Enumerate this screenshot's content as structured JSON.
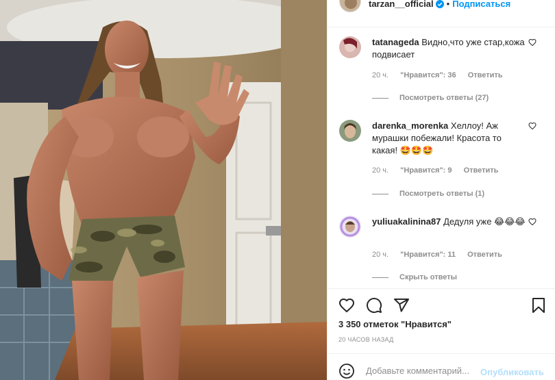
{
  "post": {
    "username": "tarzan__official",
    "verified": true,
    "separator": "•",
    "follow_label": "Подписаться"
  },
  "comments": [
    {
      "username": "tatanageda",
      "text": "Видно,что уже стар,кожа подвисает",
      "age": "20 ч.",
      "likes_label": "\"Нравится\": 36",
      "reply_label": "Ответить",
      "replies_label": "Посмотреть ответы (27)"
    },
    {
      "username": "darenka_morenka",
      "text": "Хеллоу! Аж мурашки побежали! Красота то какая! 🤩🤩🤩",
      "age": "20 ч.",
      "likes_label": "\"Нравится\": 9",
      "reply_label": "Ответить",
      "replies_label": "Посмотреть ответы (1)"
    },
    {
      "username": "yuliuakalinina87",
      "text": "Дедуля уже 😂😂😂",
      "age": "20 ч.",
      "likes_label": "\"Нравится\": 11",
      "reply_label": "Ответить",
      "replies_label": "Скрыть ответы"
    }
  ],
  "actions": {
    "icons": [
      "heart-icon",
      "comment-icon",
      "share-icon",
      "bookmark-icon"
    ]
  },
  "likes_text": "3 350 отметок \"Нравится\"",
  "posted_time": "20 часов назад",
  "add_comment": {
    "placeholder": "Добавьте комментарий...",
    "publish_label": "Опубликовать"
  },
  "colors": {
    "accent": "#0095f6",
    "publish_disabled": "#b2dffc",
    "muted": "#8e8e8e",
    "text": "#262626"
  }
}
